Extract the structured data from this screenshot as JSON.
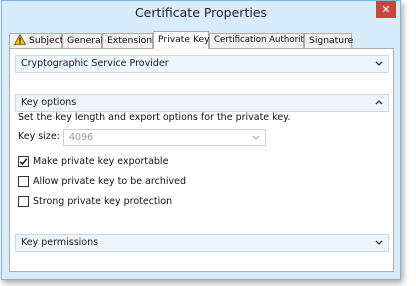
{
  "window": {
    "title": "Certificate Properties",
    "close_glyph": "✕"
  },
  "tabs": [
    {
      "label": "Subject",
      "icon": "warning-icon",
      "active": false
    },
    {
      "label": "General",
      "active": false
    },
    {
      "label": "Extensions",
      "active": false
    },
    {
      "label": "Private Key",
      "active": true
    },
    {
      "label": "Certification Authority",
      "active": false
    },
    {
      "label": "Signature",
      "active": false
    }
  ],
  "sections": {
    "csp": {
      "label": "Cryptographic Service Provider",
      "state": "collapsed"
    },
    "key_options": {
      "label": "Key options",
      "state": "expanded"
    },
    "key_permissions": {
      "label": "Key permissions",
      "state": "collapsed"
    }
  },
  "key_options": {
    "description": "Set the key length and export options for the private key.",
    "key_size_label": "Key size:",
    "key_size_value": "4096",
    "key_size_disabled": true,
    "checkboxes": [
      {
        "label": "Make private key exportable",
        "checked": true
      },
      {
        "label": "Allow private key to be archived",
        "checked": false
      },
      {
        "label": "Strong private key protection",
        "checked": false
      }
    ]
  },
  "colors": {
    "accent": "#d9ecfb",
    "close": "#c9463d",
    "warning": "#f2c318"
  }
}
